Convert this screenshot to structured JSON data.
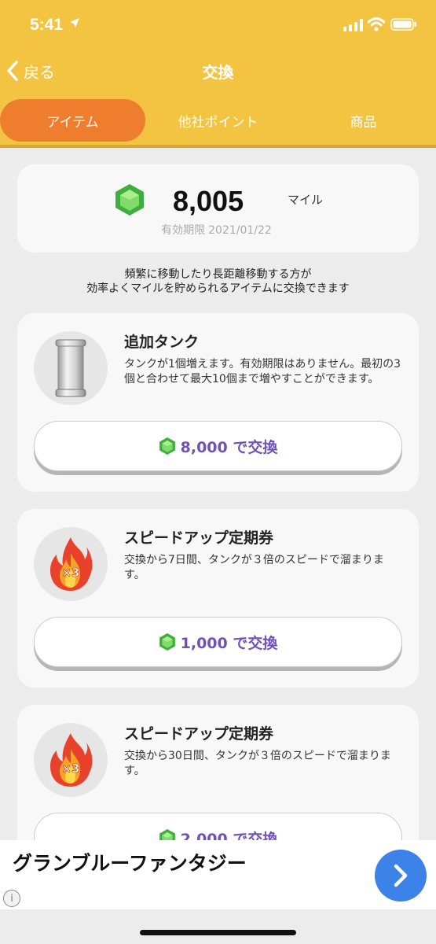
{
  "status_bar": {
    "time": "5:41"
  },
  "nav": {
    "back_label": "戻る",
    "title": "交換"
  },
  "tabs": [
    {
      "label": "アイテム",
      "active": true
    },
    {
      "label": "他社ポイント",
      "active": false
    },
    {
      "label": "商品",
      "active": false
    }
  ],
  "miles": {
    "value": "8,005",
    "unit": "マイル",
    "expiry_label": "有効期限",
    "expiry_date": "2021/01/22"
  },
  "description": {
    "line1": "頻繁に移動したり長距離移動する方が",
    "line2": "効率よくマイルを貯められるアイテムに交換できます"
  },
  "items": [
    {
      "title": "追加タンク",
      "text": "タンクが1個増えます。有効期限はありません。最初の3個と合わせて最大10個まで増やすことができます。",
      "button": "8,000 で交換",
      "icon": "tank-icon"
    },
    {
      "title": "スピードアップ定期券",
      "text": "交換から7日間、タンクが３倍のスピードで溜まります。",
      "button": "1,000 で交換",
      "icon": "fire-x3-icon",
      "badge": "×3"
    },
    {
      "title": "スピードアップ定期券",
      "text": "交換から30日間、タンクが３倍のスピードで溜まります。",
      "button": "2,000 で交換",
      "icon": "fire-x3-icon",
      "badge": "×3"
    }
  ],
  "ad": {
    "title": "グランブルーファンタジー",
    "info": "i"
  },
  "colors": {
    "header": "#f3c442",
    "active_tab": "#ef7d2e",
    "button_text": "#6f51b8",
    "gem": "#4cc04a",
    "ad_button": "#3d82e8"
  }
}
